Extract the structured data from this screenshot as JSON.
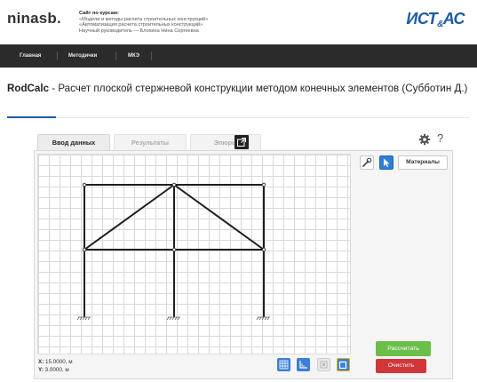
{
  "header": {
    "logo_left": "ninasb.",
    "course_title": "Сайт по курсам:",
    "course_line1": "«Модели и методы расчета строительных конструкций»",
    "course_line2": "«Автоматизация расчета строительных конструкций»",
    "course_line3": "Научный руководитель — Блохина Нина Сергеевна",
    "logo_right_main": "ИСТ",
    "logo_right_amp": "&",
    "logo_right_end": "АС"
  },
  "nav": {
    "items": [
      {
        "label": "Главная"
      },
      {
        "label": "Методички"
      },
      {
        "label": "МКЭ"
      }
    ]
  },
  "title": {
    "app_name": "RodCalc",
    "text": " - Расчет плоской стержневой конструкции методом конечных элементов (Субботин Д.)"
  },
  "tabs": [
    {
      "label": "Ввод данных",
      "active": true
    },
    {
      "label": "Результаты",
      "active": false
    },
    {
      "label": "Эпюры",
      "active": false
    }
  ],
  "toolbar": {
    "materials_label": "Материалы",
    "calc_label": "Рассчитать",
    "clear_label": "Очистить"
  },
  "status": {
    "x_label": "X:",
    "x_value": "15.0000, м",
    "y_label": "Y:",
    "y_value": "3.0000, м"
  },
  "colors": {
    "brand_blue": "#1c5aa6",
    "nav_bg": "#2b2b2b",
    "calc_green": "#6cbe4a",
    "clear_red": "#d2363a",
    "tool_blue": "#2f7fd6"
  },
  "icons": {
    "popout": "external-link-icon",
    "settings": "gear-icon",
    "help": "question-icon",
    "wrench": "wrench-icon",
    "pointer": "cursor-icon",
    "grid": "grid-icon",
    "axes": "axes-icon",
    "snap": "snap-icon",
    "frame": "frame-icon"
  }
}
